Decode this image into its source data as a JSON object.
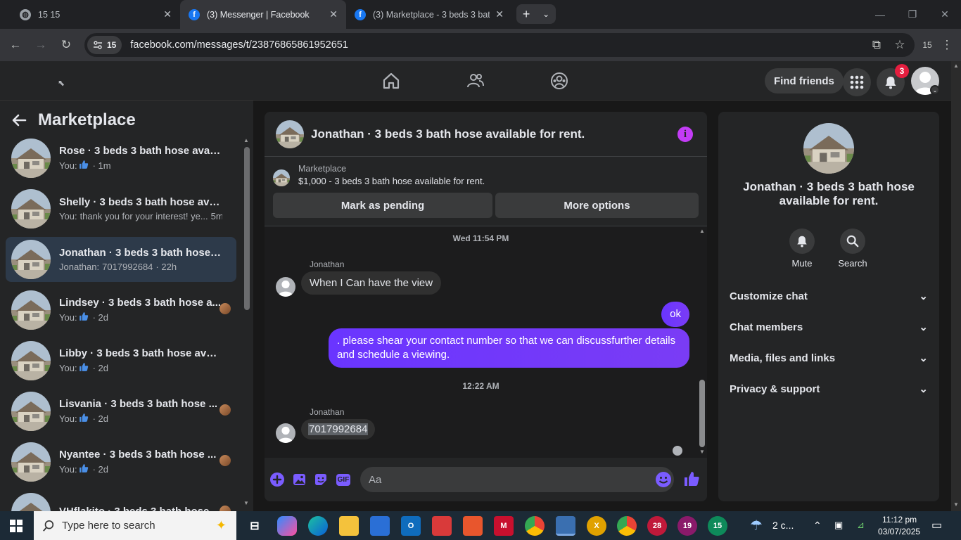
{
  "browser": {
    "tabs": [
      {
        "label": "15 15",
        "icon": "globe-icon"
      },
      {
        "label": "(3) Messenger | Facebook",
        "icon": "facebook-icon"
      },
      {
        "label": "(3) Marketplace - 3 beds 3 bath",
        "icon": "facebook-icon"
      }
    ],
    "site_chip": "15",
    "url": "facebook.com/messages/t/23876865861952651",
    "profile_count": "15"
  },
  "fbnav": {
    "find_friends": "Find friends",
    "notifications_count": "3"
  },
  "left": {
    "title": "Marketplace",
    "conversations": [
      {
        "name": "Rose · 3 beds 3 bath hose availa...",
        "prefix": "You:",
        "like": true,
        "text": "",
        "time": "· 1m",
        "seen": false
      },
      {
        "name": "Shelly · 3 beds 3 bath hose avail...",
        "prefix": "You:",
        "like": false,
        "text": "thank you for your interest! ye...",
        "time": "5m",
        "seen": false
      },
      {
        "name": "Jonathan · 3 beds 3 bath hose a...",
        "prefix": "Jonathan:",
        "like": false,
        "text": "7017992684",
        "time": "· 22h",
        "seen": false
      },
      {
        "name": "Lindsey · 3 beds 3 bath hose a...",
        "prefix": "You:",
        "like": true,
        "text": "",
        "time": "· 2d",
        "seen": true
      },
      {
        "name": "Libby · 3 beds 3 bath hose availa...",
        "prefix": "You:",
        "like": true,
        "text": "",
        "time": "· 2d",
        "seen": false
      },
      {
        "name": "Lisvania · 3 beds 3 bath hose ...",
        "prefix": "You:",
        "like": true,
        "text": "",
        "time": "· 2d",
        "seen": true
      },
      {
        "name": "Nyantee · 3 beds 3 bath hose ...",
        "prefix": "You:",
        "like": true,
        "text": "",
        "time": "· 2d",
        "seen": true
      },
      {
        "name": "VHflakito · 3 beds 3 bath hose...",
        "prefix": "",
        "like": false,
        "text": "",
        "time": "",
        "seen": true
      }
    ]
  },
  "chat": {
    "title": "Jonathan · 3 beds 3 bath hose available for rent.",
    "info_glyph": "i",
    "marketplace_label": "Marketplace",
    "listing": "$1,000 - 3 beds 3 bath hose available for rent.",
    "mark_pending": "Mark as pending",
    "more_options": "More options",
    "messages": {
      "ts1": "Wed 11:54 PM",
      "sender1": "Jonathan",
      "in1": "When I Can have the view",
      "out1": "ok",
      "out2": ". please shear your contact number so that we can discussfurther details and schedule a viewing.",
      "ts2": "12:22 AM",
      "sender2": "Jonathan",
      "in2": "7017992684"
    },
    "composer_placeholder": "Aa",
    "gif_label": "GIF"
  },
  "right": {
    "title": "Jonathan · 3 beds 3 bath hose available for rent.",
    "mute": "Mute",
    "search": "Search",
    "sections": [
      "Customize chat",
      "Chat members",
      "Media, files and links",
      "Privacy & support"
    ]
  },
  "taskbar": {
    "search_placeholder": "Type here to search",
    "weather": "2 c...",
    "time": "11:12 pm",
    "date": "03/07/2025",
    "badges": [
      "28",
      "19",
      "15"
    ]
  },
  "colors": {
    "accent_purple": "#7a3cf5",
    "fb_blue": "#1877f2",
    "badge_red": "#e41e3f",
    "info_purple": "#c33cf6"
  }
}
